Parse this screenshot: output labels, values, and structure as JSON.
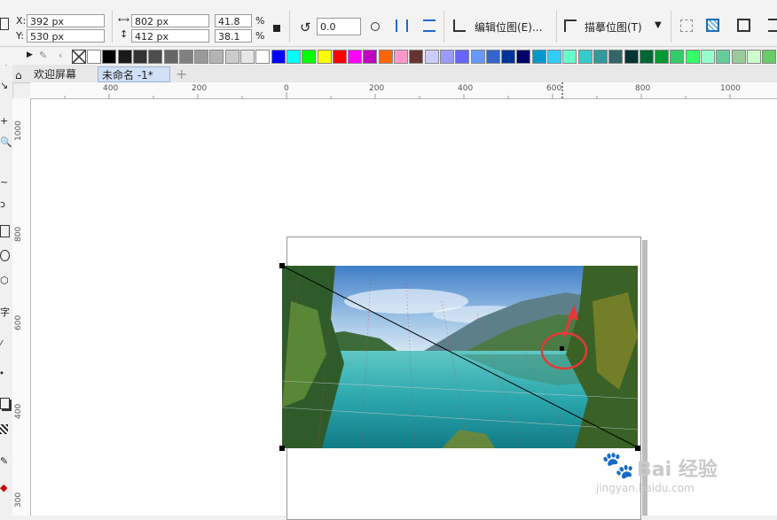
{
  "props": {
    "x_label": "X:",
    "x_value": "392 px",
    "y_label": "Y:",
    "y_value": "530 px",
    "w_value": "802 px",
    "h_value": "412 px",
    "scale_w": "41.8",
    "scale_h": "38.1",
    "pct1": "%",
    "pct2": "%",
    "rotate_value": "0.0",
    "edit_bitmap_label": "编辑位图(E)...",
    "trace_bitmap_label": "描摹位图(T)"
  },
  "tabs": {
    "welcome": "欢迎屏幕",
    "doc": "未命名 -1*",
    "add": "+"
  },
  "ruler": {
    "h_ticks": [
      "400",
      "200",
      "0",
      "200",
      "400",
      "600",
      "800",
      "1000"
    ],
    "v_ticks": [
      "1000",
      "800",
      "600",
      "400",
      "300"
    ]
  },
  "palette": [
    "#ffffff",
    "#000000",
    "#1a1a1a",
    "#333333",
    "#4d4d4d",
    "#666666",
    "#808080",
    "#999999",
    "#b3b3b3",
    "#cccccc",
    "#e6e6e6",
    "#ffffff",
    "#0000ff",
    "#00ffff",
    "#00ff00",
    "#ffff00",
    "#ff0000",
    "#ff00ff",
    "#c000c0",
    "#ff6600",
    "#ff99cc",
    "#663333",
    "#ccccff",
    "#9999ff",
    "#6666ff",
    "#6699ff",
    "#3366cc",
    "#003399",
    "#000066",
    "#0099cc",
    "#33ccff",
    "#66ffcc",
    "#33cccc",
    "#339999",
    "#336666",
    "#003333",
    "#006633",
    "#009933",
    "#33cc66",
    "#33ff66",
    "#99ffcc",
    "#66cc99",
    "#99cc99",
    "#ccffcc",
    "#66cc66"
  ],
  "watermark": {
    "main": "Bai 经验",
    "sub": "jingyan.baidu.com"
  },
  "colors": {
    "accent": "#e53935",
    "tab_active": "#cfe0f7"
  }
}
